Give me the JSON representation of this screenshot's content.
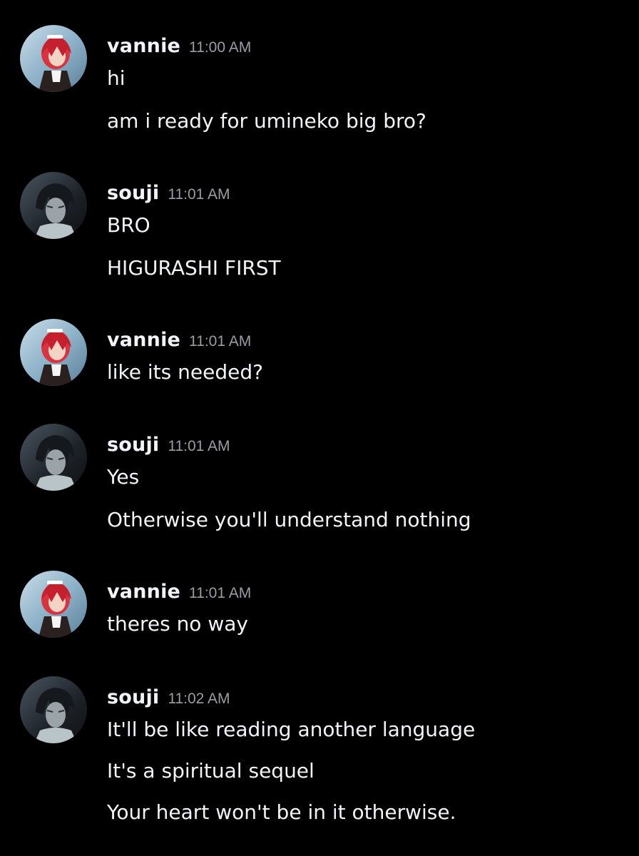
{
  "colors": {
    "background": "#000000",
    "text": "#f2f3f5",
    "timestamp": "#9a9da3"
  },
  "messages": [
    {
      "author": "vannie",
      "avatar": "vannie-avatar-icon",
      "time": "11:00 AM",
      "lines": [
        "hi",
        "am i ready for umineko big bro?"
      ]
    },
    {
      "author": "souji",
      "avatar": "souji-avatar-icon",
      "time": "11:01 AM",
      "lines": [
        "BRO",
        "HIGURASHI FIRST"
      ]
    },
    {
      "author": "vannie",
      "avatar": "vannie-avatar-icon",
      "time": "11:01 AM",
      "lines": [
        "like its needed?"
      ]
    },
    {
      "author": "souji",
      "avatar": "souji-avatar-icon",
      "time": "11:01 AM",
      "lines": [
        "Yes",
        "Otherwise you'll understand nothing"
      ]
    },
    {
      "author": "vannie",
      "avatar": "vannie-avatar-icon",
      "time": "11:01 AM",
      "lines": [
        "theres no way"
      ]
    },
    {
      "author": "souji",
      "avatar": "souji-avatar-icon",
      "time": "11:02 AM",
      "lines": [
        "It'll be like reading another language",
        "It's a spiritual sequel",
        "Your heart won't be in it otherwise."
      ]
    }
  ]
}
